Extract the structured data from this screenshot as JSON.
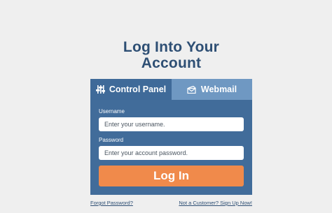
{
  "page": {
    "title": "Log Into Your Account"
  },
  "tabs": [
    {
      "label": "Control Panel",
      "icon": "sliders-icon",
      "active": true
    },
    {
      "label": "Webmail",
      "icon": "envelope-icon",
      "active": false
    }
  ],
  "form": {
    "username_label": "Username",
    "username_placeholder": "Enter your username.",
    "username_value": "",
    "password_label": "Password",
    "password_placeholder": "Enter your account password.",
    "password_value": "",
    "submit_label": "Log In"
  },
  "links": {
    "forgot": "Forgot Password?",
    "signup": "Not a Customer? Sign Up Now!"
  },
  "colors": {
    "title": "#2e4f74",
    "panel": "#416c9a",
    "active_tab": "#3f6a99",
    "inactive_tab": "#6f98c2",
    "button": "#f08a4b",
    "background": "#efefef"
  }
}
